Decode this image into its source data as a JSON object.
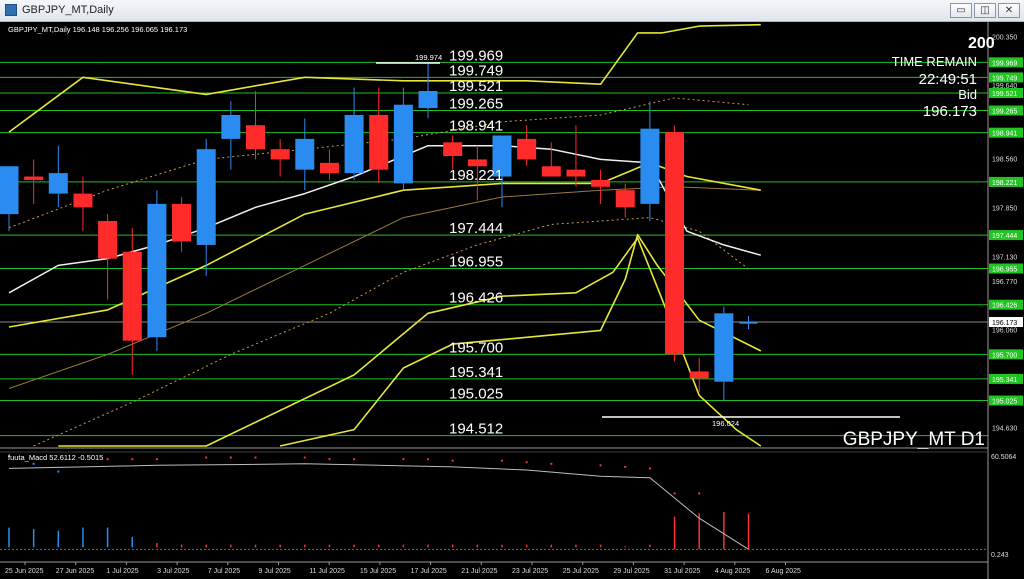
{
  "window": {
    "title": "GBPJPY_MT,Daily",
    "buttons": {
      "minimize": "▭",
      "restore": "◫",
      "close": "✕"
    }
  },
  "chart_info": {
    "header": "GBPJPY_MT,Daily  196.148 196.256 196.065 196.173",
    "watermark": "GBPJPY_MT D1",
    "corner_value": "200",
    "time_remain_label": "TIME REMAIN",
    "time_remain_value": "22:49:51",
    "bid_label": "Bid",
    "bid_value": "196.173",
    "high_marker": "199.974",
    "low_marker": "196.024",
    "indicator_label": "fuuta_Macd 52.6112 -0.5015"
  },
  "colors": {
    "bull": "#2a8cf0",
    "bear": "#ff2a2a",
    "level_line": "#1fbf1f",
    "level_badge": "#22c422",
    "band": "#e6e63a",
    "ma_white": "#f0f0f0",
    "ma_brown": "#9a7a3c"
  },
  "chart_data": {
    "type": "candlestick",
    "y_range": [
      194.36,
      200.53
    ],
    "price_ticks": [
      "200.350",
      "199.640",
      "198.560",
      "197.850",
      "197.130",
      "196.770",
      "196.060",
      "194.630"
    ],
    "dates": [
      "25 Jun 2025",
      "27 Jun 2025",
      "1 Jul 2025",
      "3 Jul 2025",
      "7 Jul 2025",
      "9 Jul 2025",
      "11 Jul 2025",
      "15 Jul 2025",
      "17 Jul 2025",
      "21 Jul 2025",
      "23 Jul 2025",
      "25 Jul 2025",
      "29 Jul 2025",
      "31 Jul 2025",
      "4 Aug 2025",
      "6 Aug 2025"
    ],
    "candles": [
      {
        "o": 197.75,
        "h": 198.35,
        "l": 197.5,
        "c": 198.45
      },
      {
        "o": 198.3,
        "h": 198.55,
        "l": 197.9,
        "c": 198.25
      },
      {
        "o": 198.05,
        "h": 198.75,
        "l": 197.85,
        "c": 198.35
      },
      {
        "o": 198.05,
        "h": 198.3,
        "l": 197.5,
        "c": 197.85
      },
      {
        "o": 197.65,
        "h": 197.75,
        "l": 196.5,
        "c": 197.1
      },
      {
        "o": 197.2,
        "h": 197.55,
        "l": 195.4,
        "c": 195.9
      },
      {
        "o": 195.95,
        "h": 198.1,
        "l": 195.75,
        "c": 197.9
      },
      {
        "o": 197.9,
        "h": 198.0,
        "l": 197.2,
        "c": 197.35
      },
      {
        "o": 197.3,
        "h": 198.85,
        "l": 196.85,
        "c": 198.7
      },
      {
        "o": 198.85,
        "h": 199.4,
        "l": 198.4,
        "c": 199.2
      },
      {
        "o": 199.05,
        "h": 199.55,
        "l": 198.55,
        "c": 198.7
      },
      {
        "o": 198.7,
        "h": 198.85,
        "l": 198.3,
        "c": 198.55
      },
      {
        "o": 198.4,
        "h": 199.15,
        "l": 198.1,
        "c": 198.85
      },
      {
        "o": 198.5,
        "h": 198.7,
        "l": 198.25,
        "c": 198.35
      },
      {
        "o": 198.35,
        "h": 199.6,
        "l": 198.25,
        "c": 199.2
      },
      {
        "o": 199.2,
        "h": 199.6,
        "l": 198.2,
        "c": 198.4
      },
      {
        "o": 198.2,
        "h": 199.6,
        "l": 198.1,
        "c": 199.35
      },
      {
        "o": 199.3,
        "h": 199.97,
        "l": 199.15,
        "c": 199.55
      },
      {
        "o": 198.8,
        "h": 198.9,
        "l": 198.4,
        "c": 198.6
      },
      {
        "o": 198.55,
        "h": 198.75,
        "l": 197.95,
        "c": 198.45
      },
      {
        "o": 198.3,
        "h": 198.9,
        "l": 197.85,
        "c": 198.9
      },
      {
        "o": 198.85,
        "h": 199.05,
        "l": 198.45,
        "c": 198.55
      },
      {
        "o": 198.45,
        "h": 198.8,
        "l": 198.3,
        "c": 198.3
      },
      {
        "o": 198.4,
        "h": 199.05,
        "l": 198.15,
        "c": 198.3
      },
      {
        "o": 198.25,
        "h": 198.4,
        "l": 197.9,
        "c": 198.15
      },
      {
        "o": 198.1,
        "h": 198.2,
        "l": 197.7,
        "c": 197.85
      },
      {
        "o": 197.9,
        "h": 199.4,
        "l": 197.65,
        "c": 199.0
      },
      {
        "o": 198.95,
        "h": 199.05,
        "l": 195.6,
        "c": 195.7
      },
      {
        "o": 195.45,
        "h": 195.65,
        "l": 195.15,
        "c": 195.35
      },
      {
        "o": 195.3,
        "h": 196.4,
        "l": 195.02,
        "c": 196.3
      },
      {
        "o": 196.15,
        "h": 196.26,
        "l": 196.07,
        "c": 196.17
      }
    ],
    "levels": [
      {
        "value": 199.969,
        "label": "199.969",
        "badge": "199.969"
      },
      {
        "value": 199.749,
        "label": "199.749",
        "badge": "199.749"
      },
      {
        "value": 199.521,
        "label": "199.521",
        "badge": "199.521"
      },
      {
        "value": 199.265,
        "label": "199.265",
        "badge": "199.265"
      },
      {
        "value": 198.941,
        "label": "198.941",
        "badge": "198.941"
      },
      {
        "value": 198.221,
        "label": "198.221",
        "badge": "198.221"
      },
      {
        "value": 197.444,
        "label": "197.444",
        "badge": "197.444"
      },
      {
        "value": 196.955,
        "label": "196.955",
        "badge": "196.955"
      },
      {
        "value": 196.426,
        "label": "196.426",
        "badge": "196.426"
      },
      {
        "value": 195.7,
        "label": "195.700",
        "badge": "195.700"
      },
      {
        "value": 195.341,
        "label": "195.341",
        "badge": "195.341"
      },
      {
        "value": 195.025,
        "label": "195.025",
        "badge": "195.025"
      },
      {
        "value": 194.512,
        "label": "194.512",
        "badge": ""
      }
    ],
    "current_price": {
      "value": 196.173,
      "label": "196.173"
    },
    "lines": {
      "upper_band": [
        {
          "i": 0,
          "v": 198.95
        },
        {
          "i": 3,
          "v": 199.75
        },
        {
          "i": 8,
          "v": 199.5
        },
        {
          "i": 12,
          "v": 199.75
        },
        {
          "i": 16,
          "v": 199.7
        },
        {
          "i": 21,
          "v": 199.7
        },
        {
          "i": 24,
          "v": 199.65
        },
        {
          "i": 25.5,
          "v": 200.4
        },
        {
          "i": 26.5,
          "v": 200.4
        },
        {
          "i": 28,
          "v": 200.5
        },
        {
          "i": 30.5,
          "v": 200.52
        }
      ],
      "mid_band": [
        {
          "i": 0,
          "v": 196.1
        },
        {
          "i": 4,
          "v": 196.35
        },
        {
          "i": 8,
          "v": 197.0
        },
        {
          "i": 12,
          "v": 197.75
        },
        {
          "i": 16,
          "v": 198.1
        },
        {
          "i": 20,
          "v": 198.2
        },
        {
          "i": 24,
          "v": 198.2
        },
        {
          "i": 26,
          "v": 198.5
        },
        {
          "i": 27.5,
          "v": 198.3
        },
        {
          "i": 30.5,
          "v": 198.1
        }
      ],
      "lower_band": [
        {
          "i": 2,
          "v": 193.3
        },
        {
          "i": 8,
          "v": 194.3
        },
        {
          "i": 14,
          "v": 195.4
        },
        {
          "i": 17,
          "v": 196.3
        },
        {
          "i": 20,
          "v": 196.55
        },
        {
          "i": 23,
          "v": 196.6
        },
        {
          "i": 24.5,
          "v": 196.9
        },
        {
          "i": 25.5,
          "v": 197.4
        },
        {
          "i": 26.5,
          "v": 196.5
        },
        {
          "i": 28,
          "v": 195.1
        },
        {
          "i": 29.5,
          "v": 194.6
        },
        {
          "i": 30.5,
          "v": 194.3
        }
      ],
      "lower_band_2": [
        {
          "i": 11,
          "v": 193.8
        },
        {
          "i": 14,
          "v": 194.6
        },
        {
          "i": 16,
          "v": 195.5
        },
        {
          "i": 18,
          "v": 195.85
        },
        {
          "i": 21,
          "v": 195.95
        },
        {
          "i": 24,
          "v": 196.05
        },
        {
          "i": 25,
          "v": 196.8
        },
        {
          "i": 25.5,
          "v": 197.45
        },
        {
          "i": 26.3,
          "v": 197.0
        },
        {
          "i": 28,
          "v": 196.2
        },
        {
          "i": 30.5,
          "v": 195.75
        }
      ],
      "ma_white": [
        {
          "i": 0,
          "v": 196.6
        },
        {
          "i": 2,
          "v": 197.0
        },
        {
          "i": 4,
          "v": 197.1
        },
        {
          "i": 6,
          "v": 197.3
        },
        {
          "i": 8,
          "v": 197.55
        },
        {
          "i": 10,
          "v": 197.85
        },
        {
          "i": 12,
          "v": 198.05
        },
        {
          "i": 14,
          "v": 198.3
        },
        {
          "i": 17,
          "v": 198.75
        },
        {
          "i": 20,
          "v": 198.75
        },
        {
          "i": 22,
          "v": 198.7
        },
        {
          "i": 24,
          "v": 198.55
        },
        {
          "i": 26,
          "v": 198.5
        },
        {
          "i": 27.5,
          "v": 197.5
        },
        {
          "i": 29,
          "v": 197.3
        },
        {
          "i": 30.5,
          "v": 197.15
        }
      ],
      "ma_brown": [
        {
          "i": 0,
          "v": 195.2
        },
        {
          "i": 4,
          "v": 195.7
        },
        {
          "i": 8,
          "v": 196.3
        },
        {
          "i": 12,
          "v": 197.0
        },
        {
          "i": 16,
          "v": 197.7
        },
        {
          "i": 20,
          "v": 198.0
        },
        {
          "i": 24,
          "v": 198.1
        },
        {
          "i": 27,
          "v": 198.15
        },
        {
          "i": 30.5,
          "v": 198.1
        }
      ],
      "dotted_upper": [
        {
          "i": 0,
          "v": 197.55
        },
        {
          "i": 4,
          "v": 198.1
        },
        {
          "i": 8,
          "v": 198.55
        },
        {
          "i": 12,
          "v": 198.7
        },
        {
          "i": 16,
          "v": 198.85
        },
        {
          "i": 20,
          "v": 199.1
        },
        {
          "i": 24,
          "v": 199.2
        },
        {
          "i": 27,
          "v": 199.45
        },
        {
          "i": 30,
          "v": 199.35
        }
      ],
      "dotted_lower": [
        {
          "i": 1,
          "v": 194.3
        },
        {
          "i": 5,
          "v": 195.0
        },
        {
          "i": 9,
          "v": 195.7
        },
        {
          "i": 13,
          "v": 196.3
        },
        {
          "i": 16,
          "v": 196.9
        },
        {
          "i": 19,
          "v": 197.3
        },
        {
          "i": 22,
          "v": 197.6
        },
        {
          "i": 26,
          "v": 197.7
        },
        {
          "i": 28,
          "v": 197.5
        },
        {
          "i": 30,
          "v": 196.95
        }
      ]
    },
    "indicator": {
      "y_ticks": [
        "60.5064",
        "0.243"
      ],
      "range": [
        -3,
        60
      ],
      "line": [
        {
          "i": 0,
          "v": 52
        },
        {
          "i": 3,
          "v": 53
        },
        {
          "i": 6,
          "v": 54
        },
        {
          "i": 9,
          "v": 54.5
        },
        {
          "i": 12,
          "v": 55
        },
        {
          "i": 15,
          "v": 54
        },
        {
          "i": 18,
          "v": 53
        },
        {
          "i": 21,
          "v": 51
        },
        {
          "i": 24,
          "v": 47
        },
        {
          "i": 26,
          "v": 46
        },
        {
          "i": 28,
          "v": 20
        },
        {
          "i": 30,
          "v": 0
        }
      ],
      "dots": [
        {
          "i": 0,
          "v": 60,
          "c": "#ff3030"
        },
        {
          "i": 1,
          "v": 55,
          "c": "#2a8cf0"
        },
        {
          "i": 2,
          "v": 50,
          "c": "#2a8cf0"
        },
        {
          "i": 4,
          "v": 58,
          "c": "#ff3030"
        },
        {
          "i": 5,
          "v": 58,
          "c": "#ff3030"
        },
        {
          "i": 6,
          "v": 58,
          "c": "#ff3030"
        },
        {
          "i": 8,
          "v": 59,
          "c": "#ff3030"
        },
        {
          "i": 9,
          "v": 59,
          "c": "#ff3030"
        },
        {
          "i": 10,
          "v": 59,
          "c": "#ff3030"
        },
        {
          "i": 12,
          "v": 59,
          "c": "#ff3030"
        },
        {
          "i": 13,
          "v": 58,
          "c": "#ff3030"
        },
        {
          "i": 14,
          "v": 58,
          "c": "#ff3030"
        },
        {
          "i": 16,
          "v": 58,
          "c": "#ff3030"
        },
        {
          "i": 17,
          "v": 58,
          "c": "#ff3030"
        },
        {
          "i": 18,
          "v": 57,
          "c": "#ff3030"
        },
        {
          "i": 20,
          "v": 57,
          "c": "#ff3030"
        },
        {
          "i": 21,
          "v": 56,
          "c": "#ff3030"
        },
        {
          "i": 22,
          "v": 55,
          "c": "#ff3030"
        },
        {
          "i": 24,
          "v": 54,
          "c": "#ff3030"
        },
        {
          "i": 25,
          "v": 53,
          "c": "#ff3030"
        },
        {
          "i": 26,
          "v": 52,
          "c": "#ff3030"
        },
        {
          "i": 27,
          "v": 36,
          "c": "#ff3030"
        },
        {
          "i": 28,
          "v": 36,
          "c": "#ff3030"
        }
      ],
      "bars": [
        {
          "i": 0,
          "v": 14,
          "c": "#2a8cf0"
        },
        {
          "i": 1,
          "v": 13,
          "c": "#2a8cf0"
        },
        {
          "i": 2,
          "v": 12,
          "c": "#2a8cf0"
        },
        {
          "i": 3,
          "v": 14,
          "c": "#2a8cf0"
        },
        {
          "i": 4,
          "v": 14,
          "c": "#2a8cf0"
        },
        {
          "i": 5,
          "v": 8,
          "c": "#2a8cf0"
        },
        {
          "i": 6,
          "v": 4,
          "c": "#ff3030"
        },
        {
          "i": 7,
          "v": 3,
          "c": "#ff3030"
        },
        {
          "i": 8,
          "v": 3,
          "c": "#ff3030"
        },
        {
          "i": 9,
          "v": 3,
          "c": "#ff3030"
        },
        {
          "i": 10,
          "v": 3,
          "c": "#ff3030"
        },
        {
          "i": 11,
          "v": 3,
          "c": "#ff3030"
        },
        {
          "i": 12,
          "v": 3,
          "c": "#ff3030"
        },
        {
          "i": 13,
          "v": 3,
          "c": "#ff3030"
        },
        {
          "i": 14,
          "v": 3,
          "c": "#ff3030"
        },
        {
          "i": 15,
          "v": 3,
          "c": "#ff3030"
        },
        {
          "i": 16,
          "v": 3,
          "c": "#ff3030"
        },
        {
          "i": 17,
          "v": 3,
          "c": "#ff3030"
        },
        {
          "i": 18,
          "v": 3,
          "c": "#ff3030"
        },
        {
          "i": 19,
          "v": 3,
          "c": "#ff3030"
        },
        {
          "i": 20,
          "v": 3,
          "c": "#ff3030"
        },
        {
          "i": 21,
          "v": 3,
          "c": "#ff3030"
        },
        {
          "i": 22,
          "v": 3,
          "c": "#ff3030"
        },
        {
          "i": 23,
          "v": 3,
          "c": "#ff3030"
        },
        {
          "i": 24,
          "v": 3,
          "c": "#ff3030"
        },
        {
          "i": 25,
          "v": 2,
          "c": "#ff3030"
        },
        {
          "i": 26,
          "v": 3,
          "c": "#ff3030"
        },
        {
          "i": 27,
          "v": 6,
          "c": "#ff3030"
        },
        {
          "i": 28,
          "v": 8,
          "c": "#ff3030"
        },
        {
          "i": 29,
          "v": 9,
          "c": "#ff3030"
        },
        {
          "i": 30,
          "v": 8,
          "c": "#ff3030"
        }
      ]
    }
  }
}
